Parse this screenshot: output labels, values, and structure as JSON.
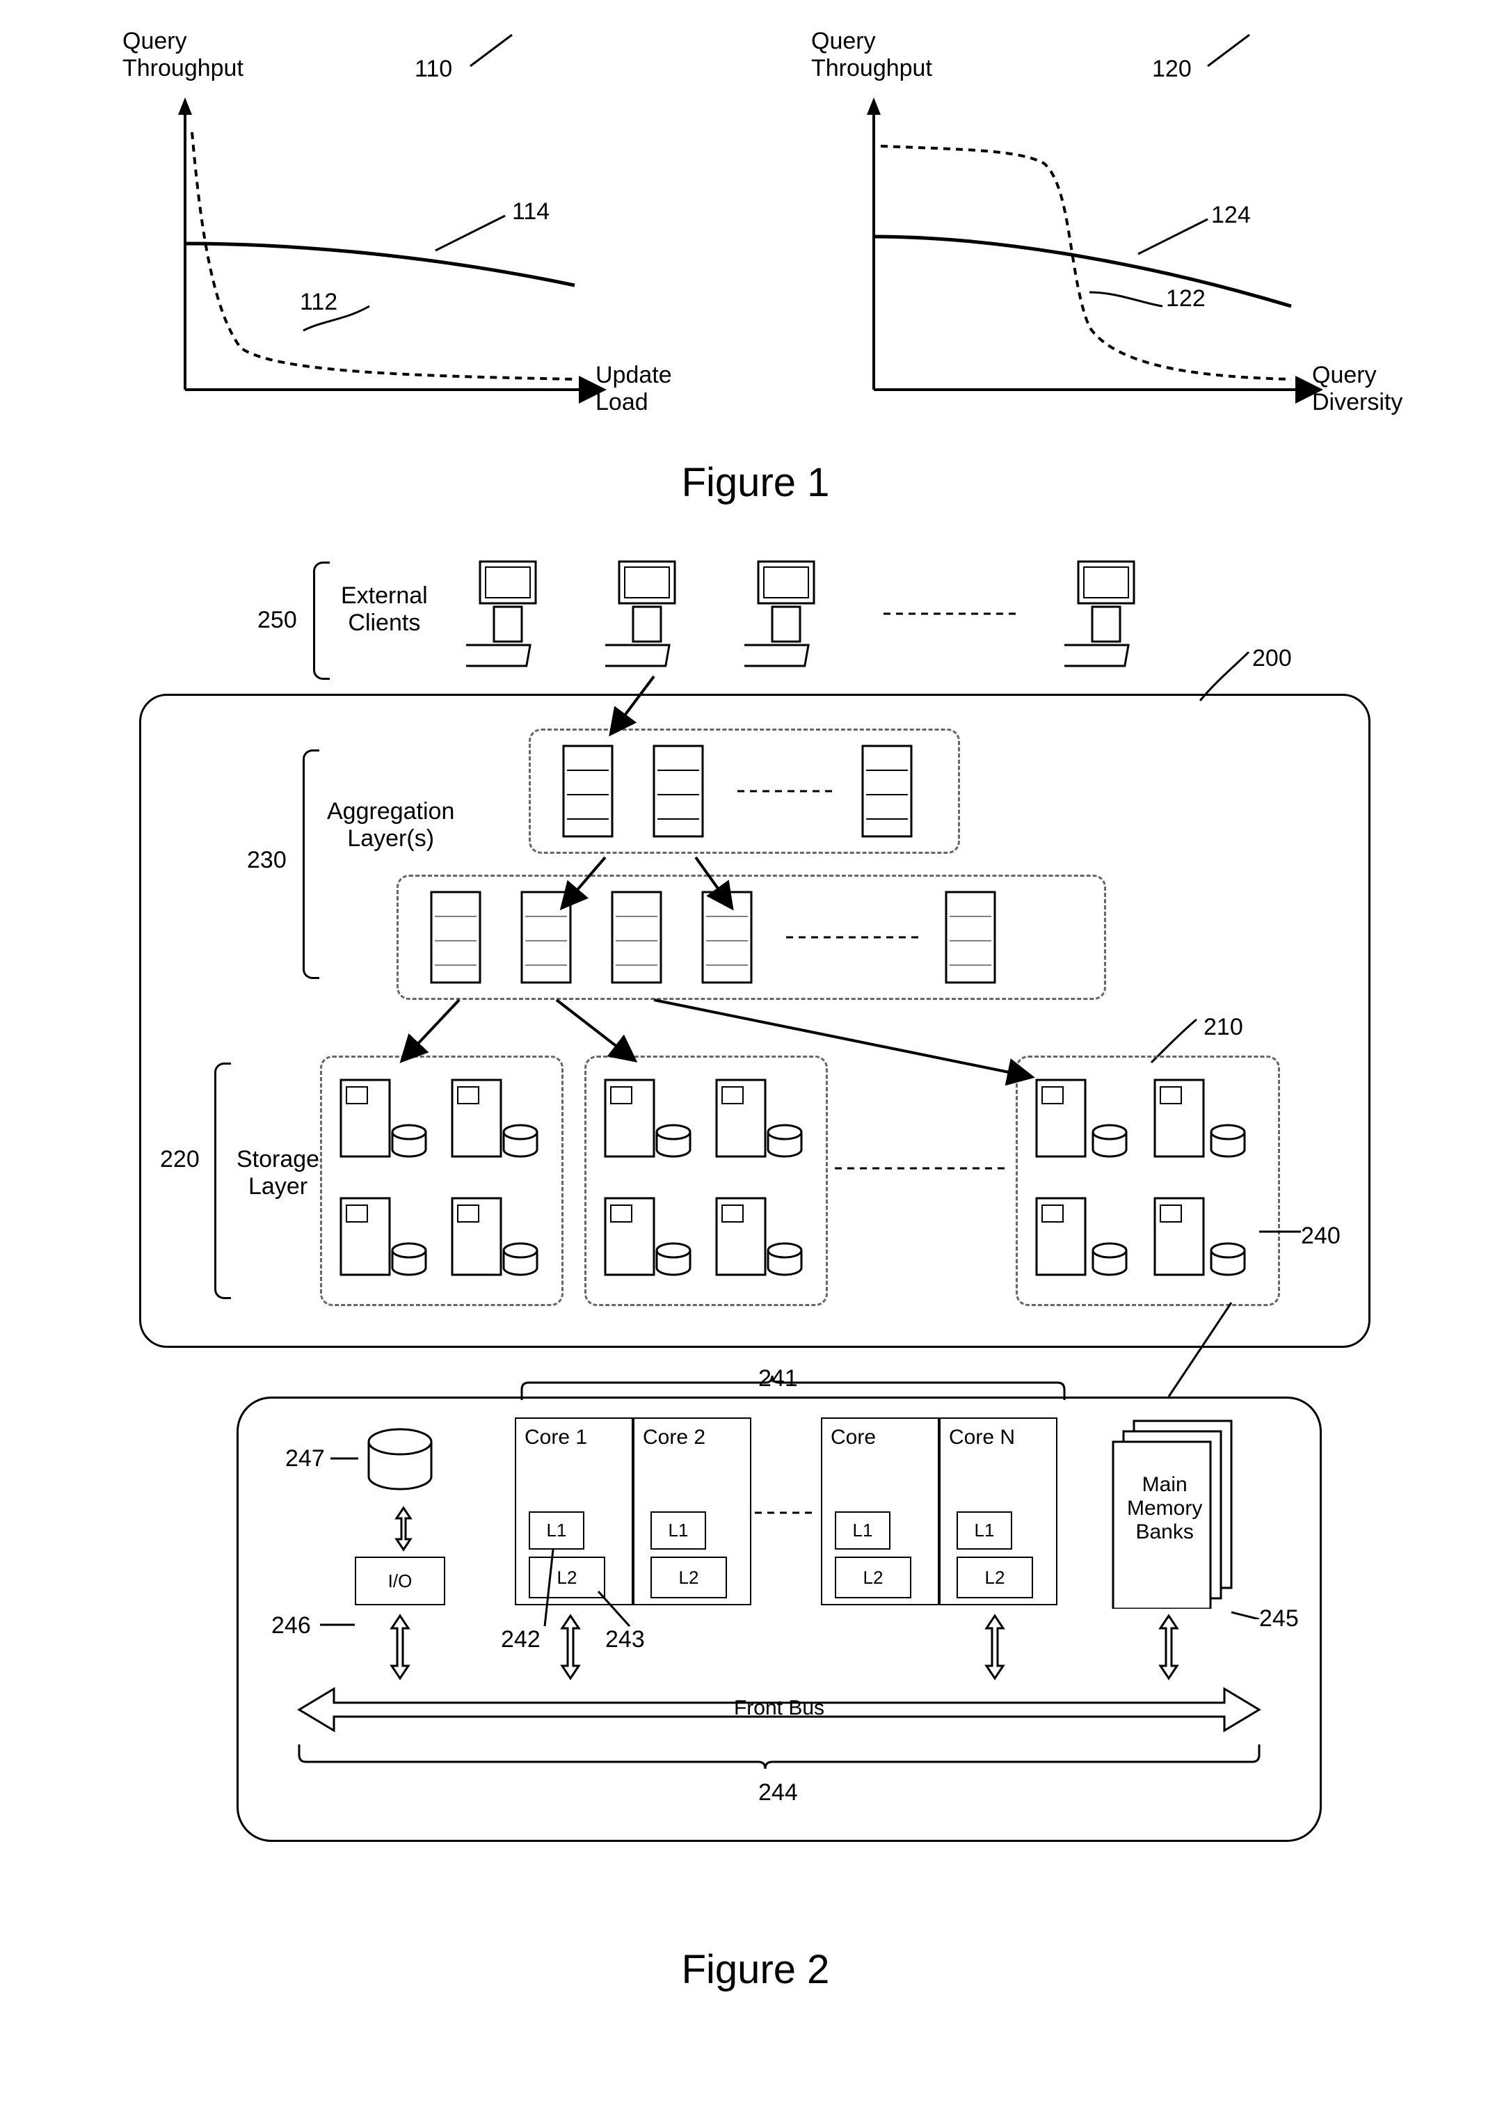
{
  "fig1": {
    "title": "Figure 1",
    "left_chart": {
      "yaxis_label": "Query\nThroughput",
      "xaxis_label": "Update\nLoad",
      "ref": "110",
      "curve_dashed_ref": "112",
      "curve_solid_ref": "114"
    },
    "right_chart": {
      "yaxis_label": "Query\nThroughput",
      "xaxis_label": "Query\nDiversity",
      "ref": "120",
      "curve_dashed_ref": "122",
      "curve_solid_ref": "124"
    }
  },
  "fig2": {
    "title": "Figure 2",
    "system_ref": "200",
    "clients": {
      "label": "External\nClients",
      "ref": "250"
    },
    "aggregation": {
      "label": "Aggregation\nLayer(s)",
      "ref": "230"
    },
    "storage": {
      "label": "Storage\nLayer",
      "ref": "220",
      "cluster_ref": "210",
      "node_ref": "240"
    },
    "node": {
      "cores_ref": "241",
      "cores": [
        "Core 1",
        "Core 2",
        "Core",
        "Core N"
      ],
      "l1_label": "L1",
      "l2_label": "L2",
      "l1_ref": "242",
      "l2_ref": "243",
      "memory_label": "Main\nMemory\nBanks",
      "memory_ref": "245",
      "io_label": "I/O",
      "io_ref": "246",
      "disk_ref": "247",
      "bus_label": "Front Bus",
      "bus_ref": "244"
    }
  },
  "chart_data": [
    {
      "type": "line",
      "title": "",
      "xlabel": "Update Load",
      "ylabel": "Query Throughput",
      "series": [
        {
          "name": "112 (dashed)",
          "x": [
            0,
            10,
            20,
            30,
            40,
            60,
            80,
            100
          ],
          "y": [
            100,
            60,
            30,
            18,
            12,
            8,
            6,
            5
          ],
          "style": "dashed"
        },
        {
          "name": "114 (solid)",
          "x": [
            0,
            20,
            40,
            60,
            80,
            100
          ],
          "y": [
            50,
            48,
            46,
            43,
            40,
            36
          ],
          "style": "solid"
        }
      ],
      "xlim": [
        0,
        100
      ],
      "ylim": [
        0,
        100
      ],
      "legend": false
    },
    {
      "type": "line",
      "title": "",
      "xlabel": "Query Diversity",
      "ylabel": "Query Throughput",
      "series": [
        {
          "name": "122 (dashed)",
          "x": [
            0,
            20,
            35,
            42,
            48,
            55,
            70,
            85,
            100
          ],
          "y": [
            90,
            89,
            87,
            75,
            40,
            20,
            12,
            8,
            6
          ],
          "style": "dashed"
        },
        {
          "name": "124 (solid)",
          "x": [
            0,
            20,
            40,
            60,
            80,
            100
          ],
          "y": [
            52,
            50,
            47,
            42,
            37,
            32
          ],
          "style": "solid"
        }
      ],
      "xlim": [
        0,
        100
      ],
      "ylim": [
        0,
        100
      ],
      "legend": false
    }
  ]
}
